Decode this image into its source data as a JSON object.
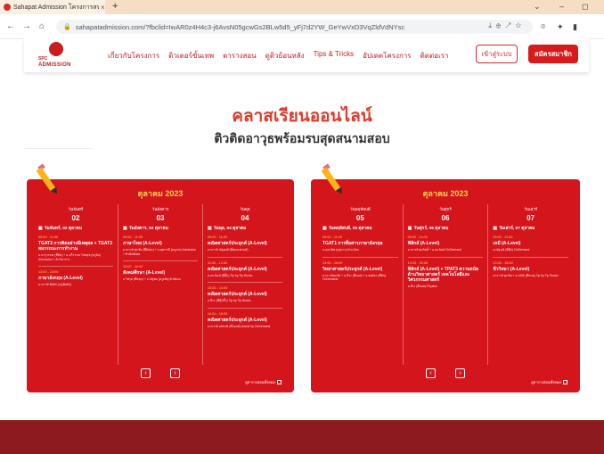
{
  "browser": {
    "tab_title": "Sahapat Admission โครงการสหพัฒน์ - Home",
    "tab_close": "×",
    "new_tab": "+",
    "url": "sahapatadmission.com/?fbclid=IwAR0z4H4c3-j6AvsN05gcwGs2BLw5d5_yFj7d2YW_GeYwVxD3VqZldVdNYsc",
    "back": "←",
    "forward": "→",
    "reload": "⟳",
    "home": "⌂",
    "lock": "🔒",
    "url_icons": "⤓⊕↗☆",
    "camera": "⌾",
    "extensions": "✦",
    "window_min": "⌄",
    "window_restore": "–",
    "window_max": "◻"
  },
  "site": {
    "logo_spc": "SPC",
    "logo_admission": "ADMISSION",
    "menu": [
      "เกี่ยวกับโครงการ",
      "ติวเตอร์ขั้นเทพ",
      "ตารางสอน",
      "ดูติวย้อนหลัง",
      "Tips & Tricks",
      "อัปเดตโครงการ",
      "ติดต่อเรา"
    ],
    "login_label": "เข้าสู่ระบบ",
    "signup_label": "สมัครสมาชิก"
  },
  "heading": "คลาสเรียนออนไลน์",
  "subheading": "ติวติดอาวุธพร้อมรบสุดสนามสอบ",
  "cards": [
    {
      "month": "ตุลาคม 2023",
      "view_all": "ดูตารางสอนทั้งหมด",
      "prev": "‹",
      "next": "›",
      "days": [
        {
          "dayname": "วันจันทร์",
          "daynum": "02",
          "fulldate": "วันจันทร์, 02 ตุลาคม",
          "sessions": [
            {
              "time": "09:00 - 11:00",
              "title": "TGAT2 การคิดอย่างมีเหตุผล + TGAT3 สมรรถนะการทำงาน",
              "teacher": "อ.จารุวรรณ (พี่ขิม) + อ.ฉวีวรรณ ไชยสุข (ครูลิน) Admission + ติววิชาการ"
            },
            {
              "time": "13:00 - 15:00",
              "title": "ภาษาอังกฤษ (A-Level)",
              "teacher": "อาจารย์ ฟิลลิป (ครูฟิลลิป)"
            }
          ]
        },
        {
          "dayname": "วันอังคาร",
          "daynum": "03",
          "fulldate": "วันอังคาร, 03 ตุลาคม",
          "sessions": [
            {
              "time": "09:00 - 11:00",
              "title": "ภาษาไทย (A-Level)",
              "teacher": "อาจารย์ ศุภชัย (พี่ศิลปะ) + อ.สุพรรณี (ครูเกด) Admission + ติวติดพิเศษ"
            },
            {
              "time": "13:00 - 15:00",
              "title": "สังคมศึกษา (A-Level)",
              "teacher": "อ.วิศรุต (พี่หรุด) + อ.ณัฐพล (ครูเต้ย) ติวสังคม"
            }
          ]
        },
        {
          "dayname": "วันพุธ",
          "daynum": "04",
          "fulldate": "วันพุธ, 04 ตุลาคม",
          "sessions": [
            {
              "time": "09:00 - 11:00",
              "title": "คณิตศาสตร์ประยุกต์ (A-Level)",
              "teacher": "อาจารย์ ณัฐพงศ์ (พี่หมอเฟรนด์)"
            },
            {
              "time": "11:00 - 12:00",
              "title": "คณิตศาสตร์ประยุกต์ (A-Level)",
              "teacher": "อ.ธนวัฒน์ (พี่ตั้ม) Tip by Tip Books"
            },
            {
              "time": "13:00 - 14:00",
              "title": "คณิตศาสตร์ประยุกต์ (A-Level)",
              "teacher": "อ.ธีระ (พี่ดุ๊กดิ๊ก) Tip by Tip Books"
            },
            {
              "time": "14:00 - 15:00",
              "title": "คณิตศาสตร์ประยุกต์ (A-Level)",
              "teacher": "อาจารย์ อภิชาติ (พี่แบงค์) Avenir by OnDemand"
            }
          ]
        }
      ]
    },
    {
      "month": "ตุลาคม 2023",
      "view_all": "ดูตารางสอนทั้งหมด",
      "prev": "‹",
      "next": "›",
      "days": [
        {
          "dayname": "วันพฤหัสบดี",
          "daynum": "05",
          "fulldate": "วันพฤหัสบดี, 05 ตุลาคม",
          "sessions": [
            {
              "time": "09:00 - 11:00",
              "title": "TGAT1 การสื่อสารภาษาอังกฤษ",
              "teacher": "อ.จุฑาทิพ (ครูดาว) Kru Dao"
            },
            {
              "time": "13:00 - 15:00",
              "title": "วิทยาศาสตร์ประยุกต์ (A-Level)",
              "teacher": "อาจารย์ศุภชัย + อ.ธีระ (พี่บอส) + อ.พงศ์ธร (พี่ตัน) OnDemand"
            }
          ]
        },
        {
          "dayname": "วันศุกร์",
          "daynum": "06",
          "fulldate": "วันศุกร์, 06 ตุลาคม",
          "sessions": [
            {
              "time": "09:00 - 11:00",
              "title": "ฟิสิกส์ (A-Level)",
              "teacher": "อาจารย์ ศุภกิตติ์ + อ.ธนวัฒน์ OnDemand"
            },
            {
              "time": "13:00 - 15:00",
              "title": "ฟิสิกส์ (A-Level) + TPAT3 ความถนัดด้านวิทยาศาสตร์ เทคโนโลยีและวิศวกรรมศาสตร์",
              "teacher": "อ.ธีระ (พี่บอส) Physics"
            }
          ]
        },
        {
          "dayname": "วันเสาร์",
          "daynum": "07",
          "fulldate": "วันเสาร์, 07 ตุลาคม",
          "sessions": [
            {
              "time": "09:00 - 11:00",
              "title": "เคมี (A-Level)",
              "teacher": "อ.ณัฐวุฒิ (พี่ตุ๊ก) OnDemand"
            },
            {
              "time": "13:00 - 15:00",
              "title": "ชีววิทยา (A-Level)",
              "teacher": "อาจารย์ ศุภชัย + อ.ปณิธิ (พี่หมอ) Tip by Tip Books"
            }
          ]
        }
      ]
    }
  ]
}
